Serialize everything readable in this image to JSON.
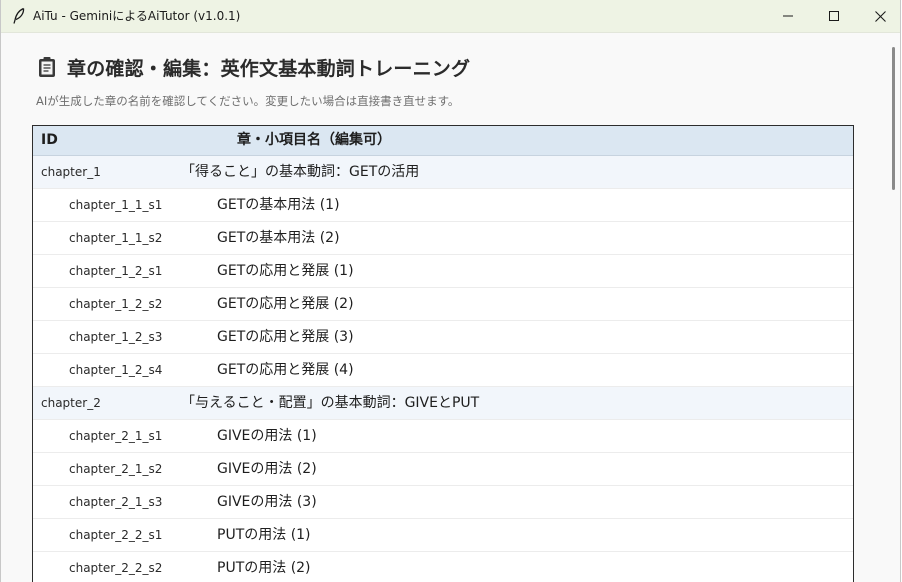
{
  "window": {
    "title": "AiTu - GeminiによるAiTutor (v1.0.1)",
    "accent": "#eef3e4"
  },
  "page": {
    "title": "章の確認・編集：英作文基本動詞トレーニング",
    "subtitle": "AIが生成した章の名前を確認してください。変更したい場合は直接書き直せます。"
  },
  "table": {
    "columns": {
      "id": "ID",
      "name": "章・小項目名（編集可）"
    },
    "rows": [
      {
        "kind": "chapter",
        "id": "chapter_1",
        "name": "「得ること」の基本動詞：GETの活用"
      },
      {
        "kind": "sub",
        "id": "chapter_1_1_s1",
        "name": "GETの基本用法 (1)"
      },
      {
        "kind": "sub",
        "id": "chapter_1_1_s2",
        "name": "GETの基本用法 (2)"
      },
      {
        "kind": "sub",
        "id": "chapter_1_2_s1",
        "name": "GETの応用と発展 (1)"
      },
      {
        "kind": "sub",
        "id": "chapter_1_2_s2",
        "name": "GETの応用と発展 (2)"
      },
      {
        "kind": "sub",
        "id": "chapter_1_2_s3",
        "name": "GETの応用と発展 (3)"
      },
      {
        "kind": "sub",
        "id": "chapter_1_2_s4",
        "name": "GETの応用と発展 (4)"
      },
      {
        "kind": "chapter",
        "id": "chapter_2",
        "name": "「与えること・配置」の基本動詞：GIVEとPUT"
      },
      {
        "kind": "sub",
        "id": "chapter_2_1_s1",
        "name": "GIVEの用法 (1)"
      },
      {
        "kind": "sub",
        "id": "chapter_2_1_s2",
        "name": "GIVEの用法 (2)"
      },
      {
        "kind": "sub",
        "id": "chapter_2_1_s3",
        "name": "GIVEの用法 (3)"
      },
      {
        "kind": "sub",
        "id": "chapter_2_2_s1",
        "name": "PUTの用法 (1)"
      },
      {
        "kind": "sub",
        "id": "chapter_2_2_s2",
        "name": "PUTの用法 (2)"
      }
    ]
  },
  "icons": {
    "app": "feather-icon",
    "page": "clipboard-icon",
    "minimize": "minimize-icon",
    "maximize": "maximize-icon",
    "close": "close-icon"
  }
}
